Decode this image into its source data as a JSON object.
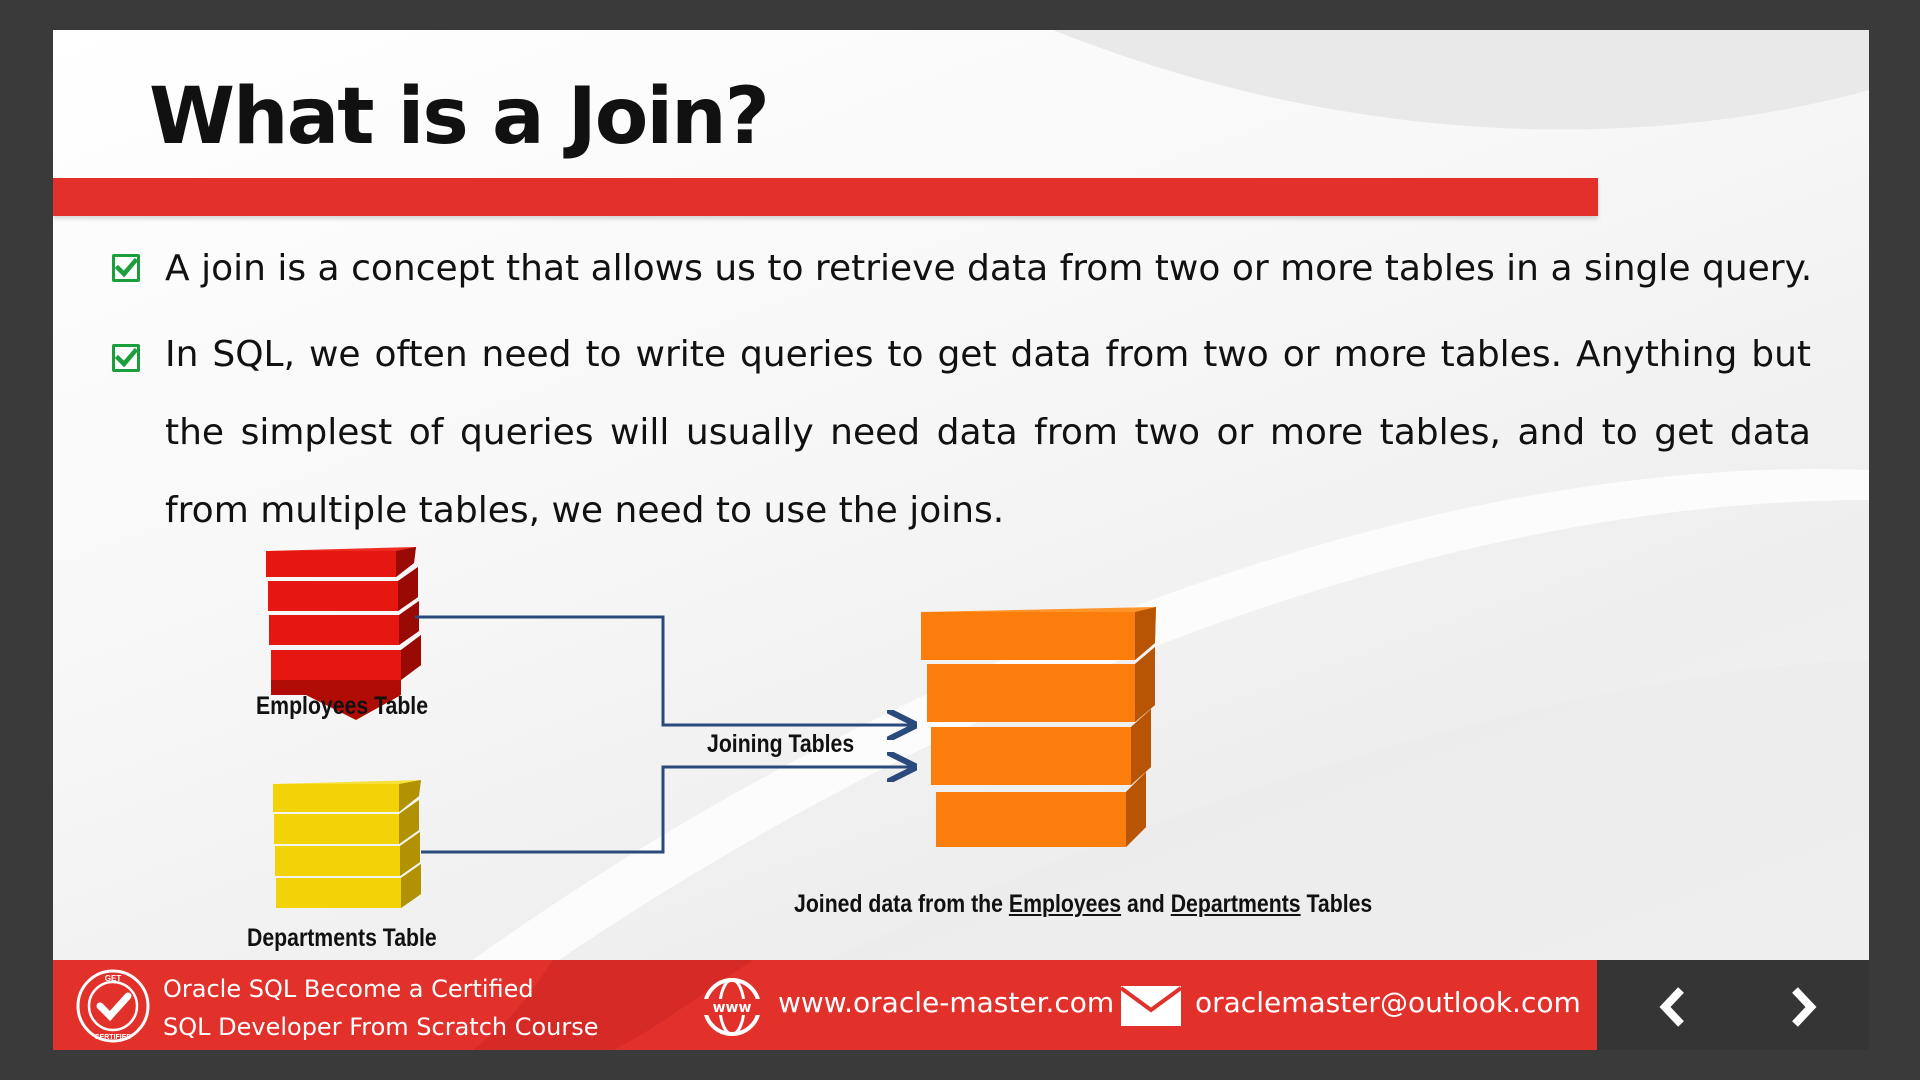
{
  "slide": {
    "title": "What is a Join?",
    "bullets": [
      "A join is a concept that allows us to retrieve data from two or more tables in a single query.",
      "In SQL, we often need to write queries to get data from two or more tables. Anything but the simplest of queries will usually need data from two or more tables, and to get data from multiple tables, we need to use the joins."
    ]
  },
  "diagram": {
    "employees_label": "Employees Table",
    "departments_label": "Departments Table",
    "joining_label": "Joining Tables",
    "result_prefix": "Joined data from the ",
    "result_employees": "Employees",
    "result_and": " and ",
    "result_departments": "Departments",
    "result_suffix": " Tables",
    "colors": {
      "employees": "#e5170f",
      "departments": "#f2d308",
      "joined": "#fb7d0c",
      "arrow": "#2b4a7c"
    }
  },
  "footer": {
    "badge_top": "GET",
    "badge_bottom": "CERTIFIED",
    "course_line1": "Oracle SQL Become a Certified",
    "course_line2": "SQL  Developer  From Scratch Course",
    "www_icon_text": "www",
    "website": "www.oracle-master.com",
    "email": "oraclemaster@outlook.com",
    "prev_icon": "chevron-left-icon",
    "next_icon": "chevron-right-icon"
  }
}
